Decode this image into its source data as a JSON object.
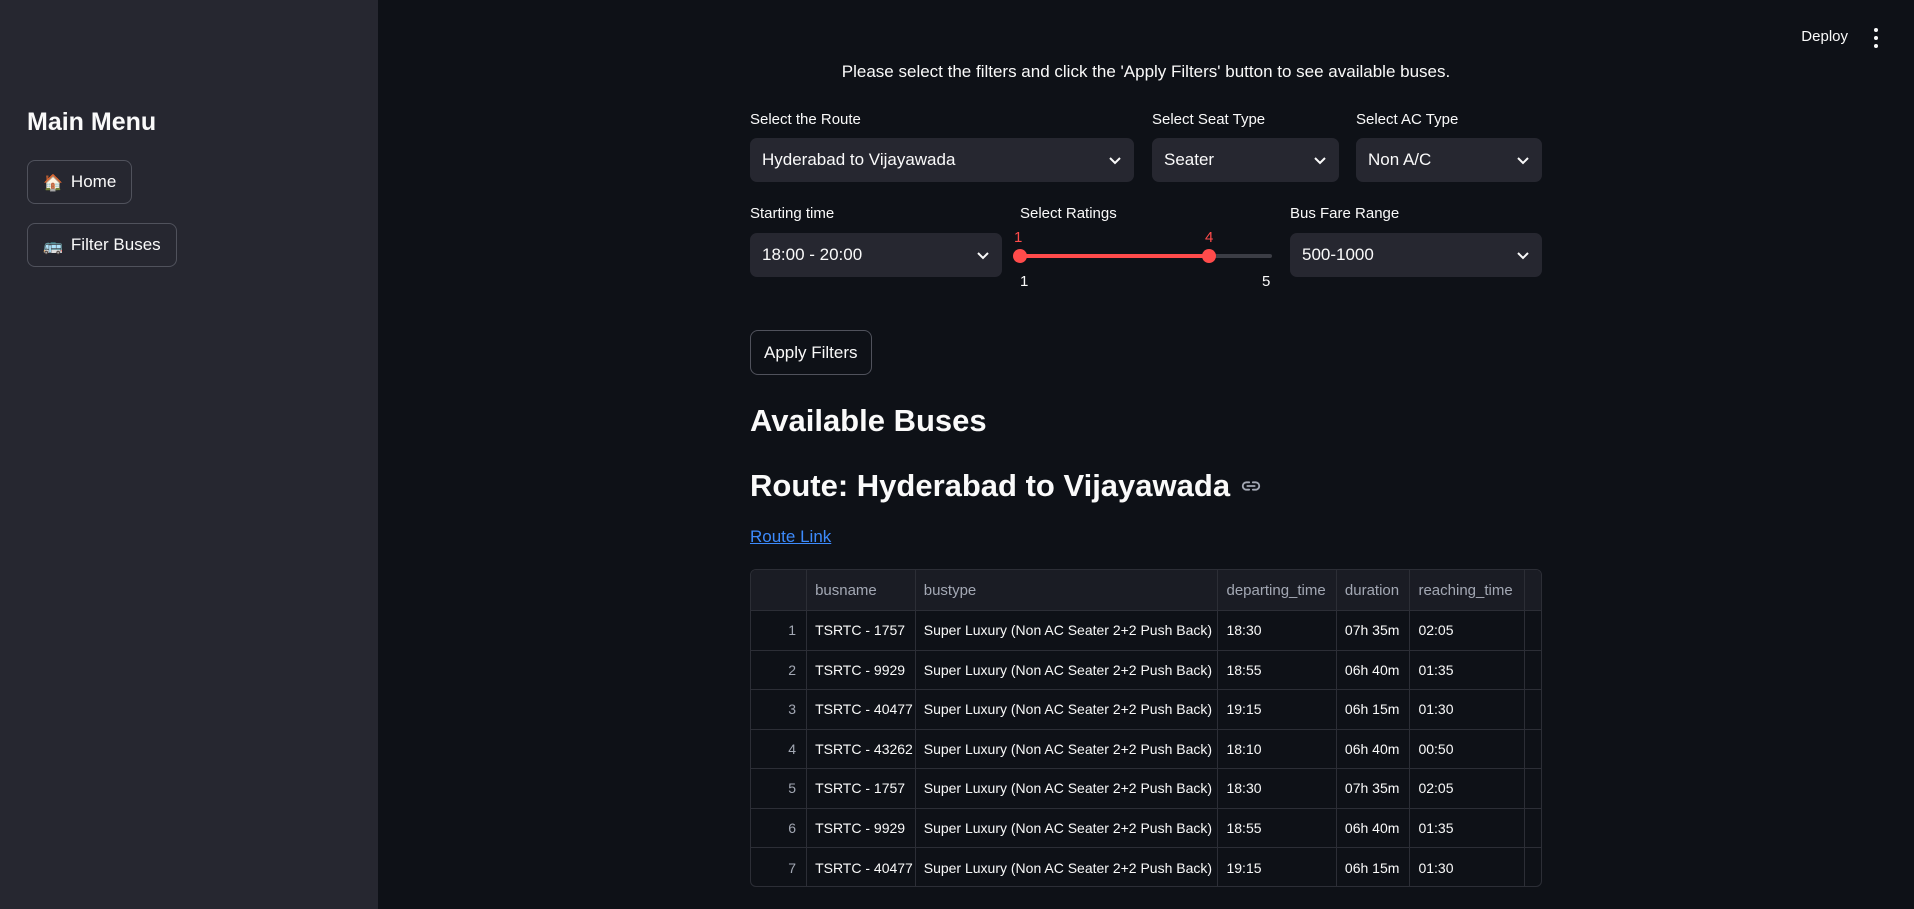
{
  "sidebar": {
    "title": "Main Menu",
    "items": [
      {
        "icon": "🏠",
        "label": "Home"
      },
      {
        "icon": "🚌",
        "label": "Filter Buses"
      }
    ]
  },
  "topbar": {
    "deploy_label": "Deploy"
  },
  "intro_text": "Please select the filters and click the 'Apply Filters' button to see available buses.",
  "filters": {
    "route": {
      "label": "Select the Route",
      "value": "Hyderabad to Vijayawada"
    },
    "seat_type": {
      "label": "Select Seat Type",
      "value": "Seater"
    },
    "ac_type": {
      "label": "Select AC Type",
      "value": "Non A/C"
    },
    "starting_time": {
      "label": "Starting time",
      "value": "18:00 - 20:00"
    },
    "ratings": {
      "label": "Select Ratings",
      "min": "1",
      "max": "5",
      "low": "1",
      "high": "4"
    },
    "fare": {
      "label": "Bus Fare Range",
      "value": "500-1000"
    }
  },
  "apply_label": "Apply Filters",
  "results": {
    "heading": "Available Buses",
    "route_heading": "Route: Hyderabad to Vijayawada",
    "route_link": "Route Link",
    "table": {
      "columns": [
        "busname",
        "bustype",
        "departing_time",
        "duration",
        "reaching_time"
      ],
      "rows": [
        {
          "idx": "1",
          "busname": "TSRTC - 1757",
          "bustype": "Super Luxury (Non AC Seater 2+2 Push Back)",
          "departing_time": "18:30",
          "duration": "07h 35m",
          "reaching_time": "02:05"
        },
        {
          "idx": "2",
          "busname": "TSRTC - 9929",
          "bustype": "Super Luxury (Non AC Seater 2+2 Push Back)",
          "departing_time": "18:55",
          "duration": "06h 40m",
          "reaching_time": "01:35"
        },
        {
          "idx": "3",
          "busname": "TSRTC - 40477",
          "bustype": "Super Luxury (Non AC Seater 2+2 Push Back)",
          "departing_time": "19:15",
          "duration": "06h 15m",
          "reaching_time": "01:30"
        },
        {
          "idx": "4",
          "busname": "TSRTC - 43262",
          "bustype": "Super Luxury (Non AC Seater 2+2 Push Back)",
          "departing_time": "18:10",
          "duration": "06h 40m",
          "reaching_time": "00:50"
        },
        {
          "idx": "5",
          "busname": "TSRTC - 1757",
          "bustype": "Super Luxury (Non AC Seater 2+2 Push Back)",
          "departing_time": "18:30",
          "duration": "07h 35m",
          "reaching_time": "02:05"
        },
        {
          "idx": "6",
          "busname": "TSRTC - 9929",
          "bustype": "Super Luxury (Non AC Seater 2+2 Push Back)",
          "departing_time": "18:55",
          "duration": "06h 40m",
          "reaching_time": "01:35"
        },
        {
          "idx": "7",
          "busname": "TSRTC - 40477",
          "bustype": "Super Luxury (Non AC Seater 2+2 Push Back)",
          "departing_time": "19:15",
          "duration": "06h 15m",
          "reaching_time": "01:30"
        }
      ]
    }
  },
  "colors": {
    "accent": "#ff4b4b",
    "link": "#3d8bfd",
    "sidebar_bg": "#262730",
    "main_bg": "#0e1117"
  }
}
